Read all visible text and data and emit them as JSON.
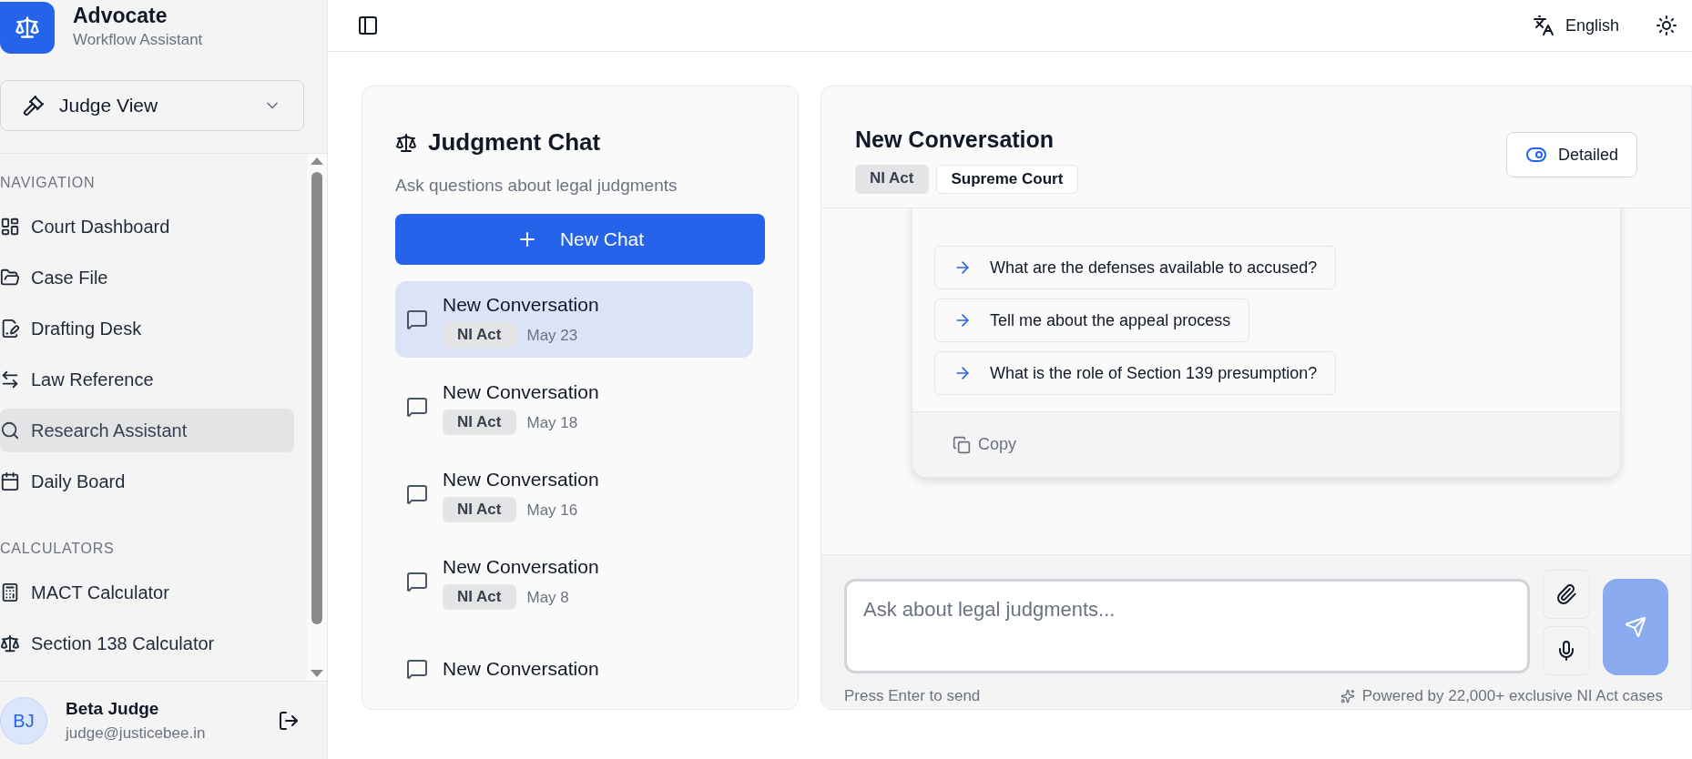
{
  "app": {
    "name": "Advocate",
    "tagline": "Workflow Assistant"
  },
  "role_selector": {
    "value": "Judge View"
  },
  "sections": [
    {
      "heading": "NAVIGATION",
      "items": [
        {
          "label": "Court Dashboard",
          "kind": "dashboard",
          "selected": false
        },
        {
          "label": "Case File",
          "kind": "folder",
          "selected": false
        },
        {
          "label": "Drafting Desk",
          "kind": "drafting",
          "selected": false
        },
        {
          "label": "Law Reference",
          "kind": "reference",
          "selected": false
        },
        {
          "label": "Research Assistant",
          "kind": "research",
          "selected": true
        },
        {
          "label": "Daily Board",
          "kind": "board",
          "selected": false
        }
      ]
    },
    {
      "heading": "CALCULATORS",
      "items": [
        {
          "label": "MACT Calculator",
          "kind": "calculator",
          "selected": false
        },
        {
          "label": "Section 138 Calculator",
          "kind": "cheque",
          "selected": false
        }
      ]
    }
  ],
  "user": {
    "initials": "BJ",
    "name": "Beta Judge",
    "email": "judge@justicebee.in"
  },
  "top_bar": {
    "language": "English"
  },
  "chat_list": {
    "title": "Judgment Chat",
    "subtitle": "Ask questions about legal judgments",
    "new_chat_button": "New Chat",
    "conversations": [
      {
        "title": "New Conversation",
        "tag": "NI Act",
        "date": "May 23",
        "selected": true
      },
      {
        "title": "New Conversation",
        "tag": "NI Act",
        "date": "May 18",
        "selected": false
      },
      {
        "title": "New Conversation",
        "tag": "NI Act",
        "date": "May 16",
        "selected": false
      },
      {
        "title": "New Conversation",
        "tag": "NI Act",
        "date": "May 8",
        "selected": false
      },
      {
        "title": "New Conversation",
        "selected": false
      }
    ]
  },
  "conversation": {
    "title": "New Conversation",
    "tags": [
      {
        "label": "NI Act",
        "kind": "filled"
      },
      {
        "label": "Supreme Court",
        "kind": "outline"
      }
    ],
    "view_toggle": {
      "label": "Detailed",
      "on": true
    },
    "suggestions": [
      "What are the defenses available to accused?",
      "Tell me about the appeal process",
      "What is the role of Section 139 presumption?"
    ],
    "copy_button": "Copy"
  },
  "composer": {
    "placeholder": "Ask about legal judgments...",
    "hint": "Press Enter to send",
    "footnote": "Powered by 22,000+ exclusive NI Act cases"
  }
}
